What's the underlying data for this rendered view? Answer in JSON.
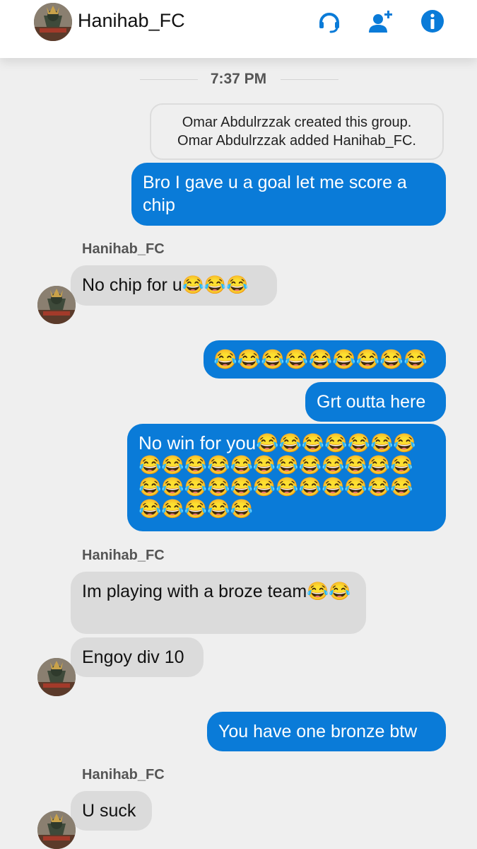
{
  "header": {
    "title": "Hanihab_FC",
    "icons": [
      "headset-icon",
      "add-person-icon",
      "info-icon"
    ],
    "accent": "#0a7bd8"
  },
  "conversation": {
    "timestamp": "7:37 PM",
    "system_lines": [
      "Omar Abdulrzzak created this group.",
      "Omar Abdulrzzak added Hanihab_FC."
    ],
    "messages": [
      {
        "dir": "out",
        "text": "Bro I gave u a goal let me score a chip"
      },
      {
        "dir": "in",
        "sender": "Hanihab_FC",
        "text": "No chip for u😂😂😂"
      },
      {
        "dir": "out",
        "text": "😂😂😂😂😂😂😂😂😂"
      },
      {
        "dir": "out",
        "text": "Grt outta here"
      },
      {
        "dir": "out",
        "text": "No win for you😂😂😂😂😂😂😂😂😂😂😂😂😂😂😂😂😂😂😂😂😂😂😂😂😂😂😂😂😂😂😂😂😂😂😂😂"
      },
      {
        "dir": "in",
        "sender": "Hanihab_FC",
        "text": "Im playing with a broze team😂😂"
      },
      {
        "dir": "in",
        "text": "Engoy div 10"
      },
      {
        "dir": "out",
        "text": "You have one bronze btw"
      },
      {
        "dir": "in",
        "sender": "Hanihab_FC",
        "text": "U suck"
      }
    ]
  }
}
